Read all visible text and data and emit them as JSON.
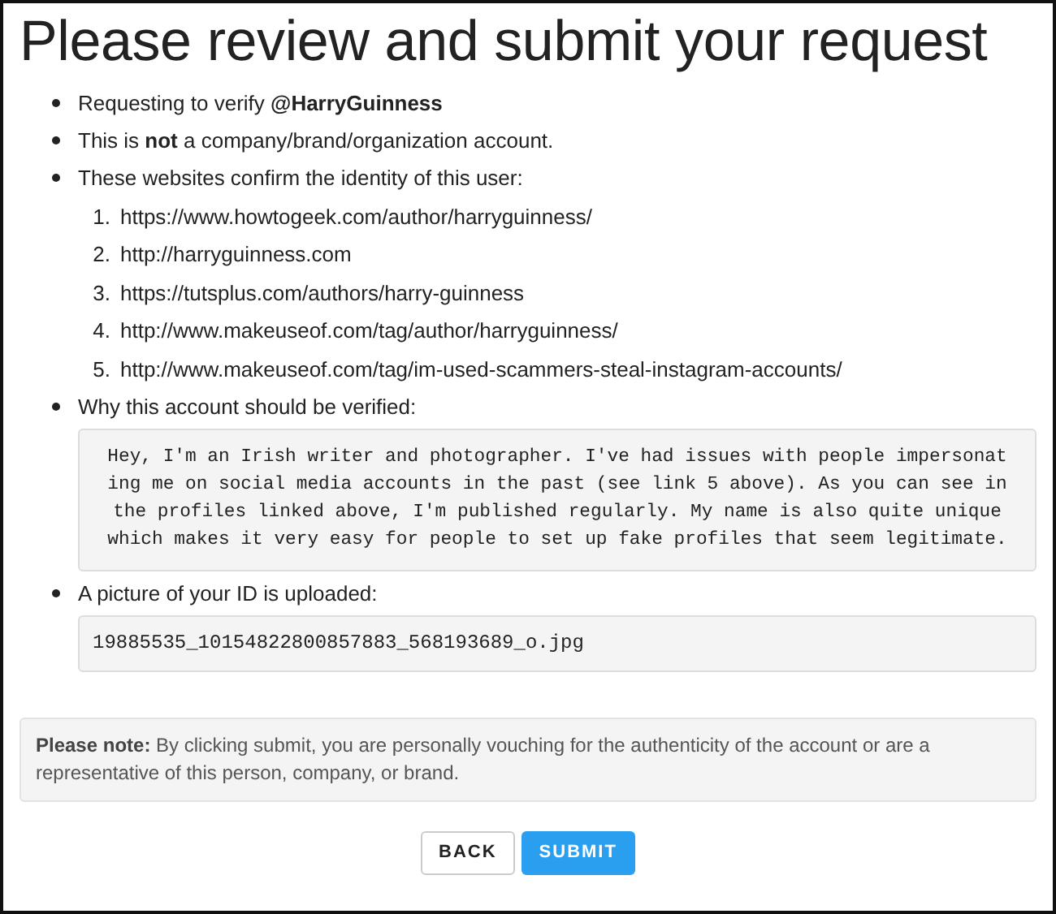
{
  "title": "Please review and submit your request",
  "items": [
    {
      "text": "Requesting to verify **@HarryGuinness**"
    },
    {
      "text": "This is **not** a company/brand/organization account."
    },
    {
      "text": "These websites confirm the identity of this user:",
      "links": [
        {
          "number": "1.",
          "url": "https://www.howtogeek.com/author/harryguinness/"
        },
        {
          "number": "2.",
          "url": "http://harryguinness.com"
        },
        {
          "number": "3.",
          "url": "https://tutsplus.com/authors/harry-guinness"
        },
        {
          "number": "4.",
          "url": "http://www.makeuseof.com/tag/author/harryguinness/"
        },
        {
          "number": "5.",
          "url": "http://www.makeuseof.com/tag/im-used-scammers-steal-instagram-accounts/"
        }
      ]
    },
    {
      "text": "Why this account should be verified:",
      "reason": "Hey, I'm an Irish writer and photographer. I've had issues with people impersonat\ning me on social media accounts in the past (see link 5 above). As you can see in\nthe profiles linked above, I'm published regularly. My name is also quite unique\nwhich makes it very easy for people to set up fake profiles that seem legitimate."
    },
    {
      "text": "A picture of your ID is uploaded:",
      "file": "19885535_10154822800857883_568193689_o.jpg"
    }
  ],
  "note": "**Please note:** By clicking submit, you are personally vouching for the authenticity of the account or are a representative of this person, company, or brand.",
  "buttons": [
    {
      "label": "BACK",
      "kind": "secondary"
    },
    {
      "label": "SUBMIT",
      "kind": "primary"
    }
  ]
}
